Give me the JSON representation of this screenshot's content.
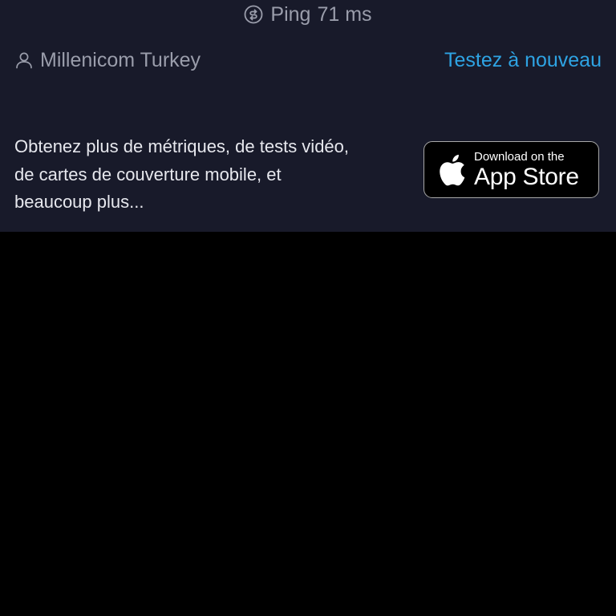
{
  "ping": {
    "icon": "ping-gauge-icon",
    "label": "Ping",
    "value": "71",
    "unit": "ms"
  },
  "provider": {
    "icon": "user-icon",
    "name": "Millenicom Turkey"
  },
  "retest_label": "Testez à nouveau",
  "promo": {
    "line1": "Obtenez plus de métriques, de tests vidéo,",
    "line2": "de cartes de couverture mobile, et",
    "line3": "beaucoup plus..."
  },
  "app_store_badge": {
    "icon": "apple-logo-icon",
    "small_text": "Download on the",
    "big_text": "App Store"
  },
  "colors": {
    "panel_bg": "#181a2a",
    "page_bg": "#000000",
    "accent": "#2ea3e3",
    "muted_text": "#9a9dab",
    "body_text": "#e7e8ee"
  }
}
